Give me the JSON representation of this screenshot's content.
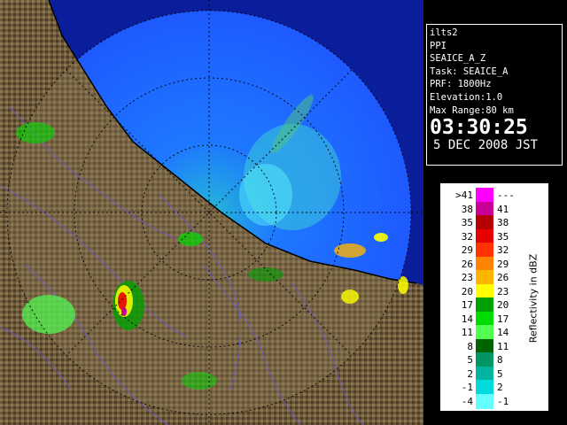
{
  "info": {
    "station": "ilts2",
    "product": "PPI",
    "scan_mode": "SEAICE_A_Z",
    "task": "Task: SEAICE_A",
    "prf": "PRF: 1800Hz",
    "elevation": "Elevation:1.0",
    "max_range": "Max Range:80 km",
    "time": "03:30:25",
    "date": "5 DEC 2008 JST"
  },
  "legend": {
    "title": "Reflectivity in dBZ",
    "rows": [
      {
        "low": ">41",
        "high": "---",
        "color": "#ff00ff"
      },
      {
        "low": "38",
        "high": "41",
        "color": "#c80096"
      },
      {
        "low": "35",
        "high": "38",
        "color": "#b40000"
      },
      {
        "low": "32",
        "high": "35",
        "color": "#e60000"
      },
      {
        "low": "29",
        "high": "32",
        "color": "#ff3200"
      },
      {
        "low": "26",
        "high": "29",
        "color": "#ff8200"
      },
      {
        "low": "23",
        "high": "26",
        "color": "#ffb400"
      },
      {
        "low": "20",
        "high": "23",
        "color": "#ffff00"
      },
      {
        "low": "17",
        "high": "20",
        "color": "#00a000"
      },
      {
        "low": "14",
        "high": "17",
        "color": "#00dc00"
      },
      {
        "low": "11",
        "high": "14",
        "color": "#50ff50"
      },
      {
        "low": "8",
        "high": "11",
        "color": "#006400"
      },
      {
        "low": "5",
        "high": "8",
        "color": "#009664"
      },
      {
        "low": "2",
        "high": "5",
        "color": "#00b4a0"
      },
      {
        "low": "-1",
        "high": "2",
        "color": "#00dcdc"
      },
      {
        "low": "-4",
        "high": "-1",
        "color": "#64ffff"
      }
    ]
  },
  "colors": {
    "sea": "#1e5aff",
    "sea_dark": "#0a1e9b",
    "land": "#6e5a3c",
    "grid": "#000000"
  }
}
